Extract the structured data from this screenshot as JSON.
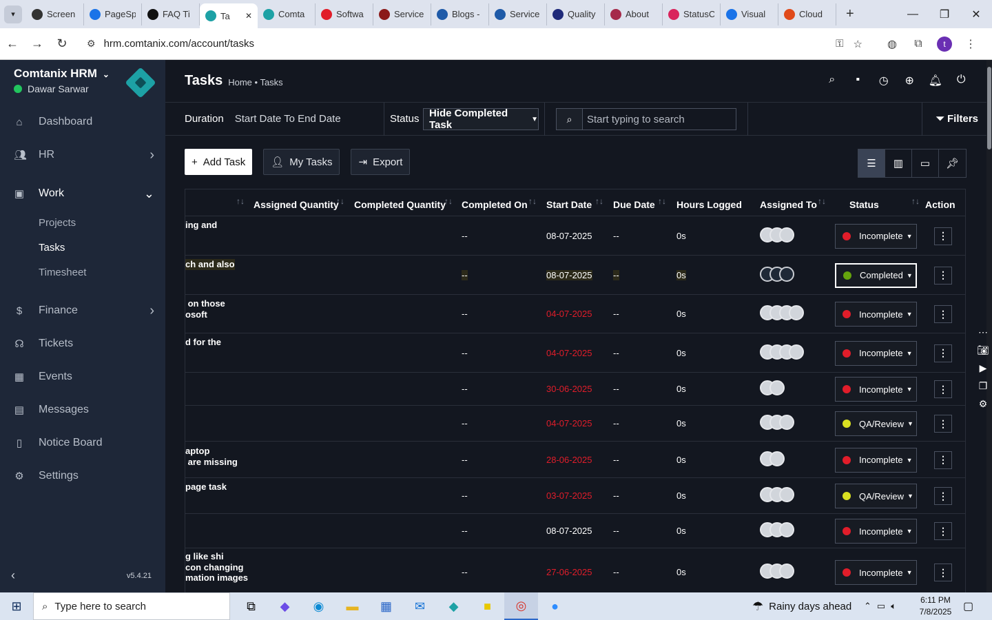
{
  "browser": {
    "tabs": [
      {
        "title": "Screen",
        "color": "#333"
      },
      {
        "title": "PageSp",
        "color": "#1a73e8"
      },
      {
        "title": "FAQ Ti",
        "color": "#111"
      },
      {
        "title": "Ta",
        "color": "#1da1a5",
        "active": true
      },
      {
        "title": "Comta",
        "color": "#1da1a5"
      },
      {
        "title": "Softwa",
        "color": "#e11d2a"
      },
      {
        "title": "Service",
        "color": "#8b1a1a"
      },
      {
        "title": "Blogs -",
        "color": "#1e5aa8"
      },
      {
        "title": "Service",
        "color": "#1e5aa8"
      },
      {
        "title": "Quality",
        "color": "#1f2a7a"
      },
      {
        "title": "About",
        "color": "#a52a4a"
      },
      {
        "title": "StatusC",
        "color": "#d9245c"
      },
      {
        "title": "Visual",
        "color": "#1a73e8"
      },
      {
        "title": "Cloud",
        "color": "#e04a1a"
      }
    ],
    "url": "hrm.comtanix.com/account/tasks",
    "profile_initial": "t"
  },
  "sidebar": {
    "brand": "Comtanix HRM",
    "user": "Dawar Sarwar",
    "version": "v5.4.21",
    "items": [
      {
        "label": "Dashboard",
        "icon": "home-icon"
      },
      {
        "label": "HR",
        "icon": "users-icon"
      },
      {
        "label": "Work",
        "icon": "briefcase-icon"
      },
      {
        "label": "Finance",
        "icon": "dollar-icon"
      },
      {
        "label": "Tickets",
        "icon": "headset-icon"
      },
      {
        "label": "Events",
        "icon": "calendar-icon"
      },
      {
        "label": "Messages",
        "icon": "message-icon"
      },
      {
        "label": "Notice Board",
        "icon": "clipboard-icon"
      },
      {
        "label": "Settings",
        "icon": "gear-icon"
      }
    ],
    "work_sub": [
      "Projects",
      "Tasks",
      "Timesheet"
    ]
  },
  "header": {
    "title": "Tasks",
    "breadcrumb": "Home • Tasks"
  },
  "filters": {
    "duration_label": "Duration",
    "duration_value": "Start Date To End Date",
    "status_label": "Status",
    "status_value": "Hide Completed Task",
    "search_placeholder": "Start typing to search",
    "filters_label": "Filters"
  },
  "actions": {
    "add": "Add Task",
    "my": "My Tasks",
    "export": "Export"
  },
  "table": {
    "columns": [
      "Assigned Quantity",
      "Completed Quantity",
      "Completed On",
      "Start Date",
      "Due Date",
      "Hours Logged",
      "Assigned To",
      "Status",
      "Action"
    ],
    "rows": [
      {
        "name": "ing and",
        "completed_on": "--",
        "start": "08-07-2025",
        "due": "--",
        "hours": "0s",
        "avatars": 3,
        "status": "Incomplete",
        "status_color": "#e11d2a",
        "start_red": false
      },
      {
        "name": "ch and also",
        "completed_on": "--",
        "start": "08-07-2025",
        "due": "--",
        "hours": "0s",
        "avatars": 3,
        "status": "Completed",
        "status_color": "#65a30d",
        "start_red": false,
        "highlight": true
      },
      {
        "name": " on those\nosoft",
        "completed_on": "--",
        "start": "04-07-2025",
        "due": "--",
        "hours": "0s",
        "avatars": 4,
        "status": "Incomplete",
        "status_color": "#e11d2a",
        "start_red": true
      },
      {
        "name": "d for the",
        "completed_on": "--",
        "start": "04-07-2025",
        "due": "--",
        "hours": "0s",
        "avatars": 4,
        "status": "Incomplete",
        "status_color": "#e11d2a",
        "start_red": true
      },
      {
        "name": "",
        "completed_on": "--",
        "start": "30-06-2025",
        "due": "--",
        "hours": "0s",
        "avatars": 2,
        "status": "Incomplete",
        "status_color": "#e11d2a",
        "start_red": true
      },
      {
        "name": "",
        "completed_on": "--",
        "start": "04-07-2025",
        "due": "--",
        "hours": "0s",
        "avatars": 3,
        "status": "QA/Review",
        "status_color": "#d9e021",
        "start_red": true
      },
      {
        "name": "aptop\n are missing",
        "completed_on": "--",
        "start": "28-06-2025",
        "due": "--",
        "hours": "0s",
        "avatars": 2,
        "status": "Incomplete",
        "status_color": "#e11d2a",
        "start_red": true
      },
      {
        "name": "page task",
        "completed_on": "--",
        "start": "03-07-2025",
        "due": "--",
        "hours": "0s",
        "avatars": 3,
        "status": "QA/Review",
        "status_color": "#d9e021",
        "start_red": true
      },
      {
        "name": "",
        "completed_on": "--",
        "start": "08-07-2025",
        "due": "--",
        "hours": "0s",
        "avatars": 3,
        "status": "Incomplete",
        "status_color": "#e11d2a",
        "start_red": false
      },
      {
        "name": "g like shi\ncon changing\nmation images",
        "completed_on": "--",
        "start": "27-06-2025",
        "due": "--",
        "hours": "0s",
        "avatars": 3,
        "status": "Incomplete",
        "status_color": "#e11d2a",
        "start_red": true
      }
    ]
  },
  "taskbar": {
    "search_placeholder": "Type here to search",
    "weather": "Rainy days ahead",
    "time": "6:11 PM",
    "date": "7/8/2025"
  }
}
